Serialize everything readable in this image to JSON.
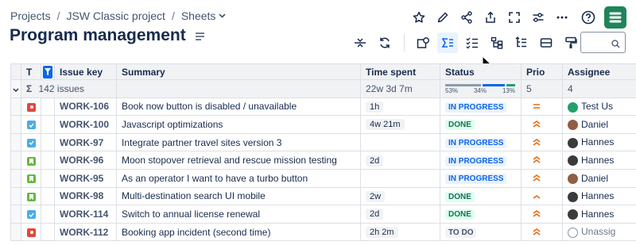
{
  "breadcrumb": {
    "items": [
      "Projects",
      "JSW Classic project",
      "Sheets"
    ],
    "separator": "/"
  },
  "page": {
    "title": "Program management"
  },
  "search": {
    "placeholder": ""
  },
  "table": {
    "headers": {
      "type": "T",
      "issue_key": "Issue key",
      "summary": "Summary",
      "time_spent": "Time spent",
      "status": "Status",
      "priority": "Prio",
      "assignee": "Assignee"
    },
    "summary_row": {
      "sigma": "Σ",
      "count": "142 issues",
      "time_spent": "22w 3d 7m",
      "status_pcts": [
        "53%",
        "34%",
        "13%"
      ],
      "status_fractions": [
        0.53,
        0.34,
        0.13
      ],
      "priority": "5",
      "assignee": "4"
    },
    "rows": [
      {
        "type": "bug",
        "key": "WORK-106",
        "summary": "Book now button is disabled / unavailable",
        "time": "1h",
        "status": "IN PROGRESS",
        "status_kind": "inprogress",
        "prio": "medium",
        "assignee": "Test Us"
      },
      {
        "type": "task",
        "key": "WORK-100",
        "summary": "Javascript optimizations",
        "time": "4w 21m",
        "status": "DONE",
        "status_kind": "done",
        "prio": "high",
        "assignee": "Daniel"
      },
      {
        "type": "task",
        "key": "WORK-97",
        "summary": "Integrate partner travel sites version 3",
        "time": "",
        "status": "IN PROGRESS",
        "status_kind": "inprogress",
        "prio": "high",
        "assignee": "Hannes"
      },
      {
        "type": "story",
        "key": "WORK-96",
        "summary": "Moon stopover retrieval and rescue mission testing",
        "time": "2d",
        "status": "IN PROGRESS",
        "status_kind": "inprogress",
        "prio": "high",
        "assignee": "Hannes"
      },
      {
        "type": "story",
        "key": "WORK-95",
        "summary": "As an operator I want to have a turbo button",
        "time": "",
        "status": "IN PROGRESS",
        "status_kind": "inprogress",
        "prio": "high",
        "assignee": "Daniel"
      },
      {
        "type": "story",
        "key": "WORK-98",
        "summary": "Multi-destination search UI mobile",
        "time": "2w",
        "status": "DONE",
        "status_kind": "done",
        "prio": "low-high",
        "assignee": "Hannes"
      },
      {
        "type": "task",
        "key": "WORK-114",
        "summary": "Switch to annual license renewal",
        "time": "2d",
        "status": "DONE",
        "status_kind": "done",
        "prio": "high",
        "assignee": "Hannes"
      },
      {
        "type": "bug",
        "key": "WORK-112",
        "summary": "Booking app incident (second time)",
        "time": "2h 2m",
        "status": "TO DO",
        "status_kind": "todo",
        "prio": "high",
        "assignee": "Unassig"
      }
    ]
  },
  "colors": {
    "accent": "#0c66e4",
    "done": "#216e4e",
    "bar_gray": "#8c9bab",
    "bar_blue": "#0c66e4",
    "bar_green": "#22a06b",
    "prio_orange": "#e56910",
    "logo": "#1f845a"
  },
  "icons": {
    "topbar": [
      "star-icon",
      "edit-pencil-icon",
      "share-icon",
      "export-icon",
      "fullscreen-icon",
      "settings-sliders-icon",
      "more-icon",
      "help-icon"
    ],
    "toolbar": [
      "collapse-rows-icon",
      "refresh-icon",
      "group-icon",
      "sum-icon",
      "checklist-icon",
      "hierarchy-icon",
      "tree-icon",
      "rows-icon",
      "paint-icon"
    ]
  }
}
